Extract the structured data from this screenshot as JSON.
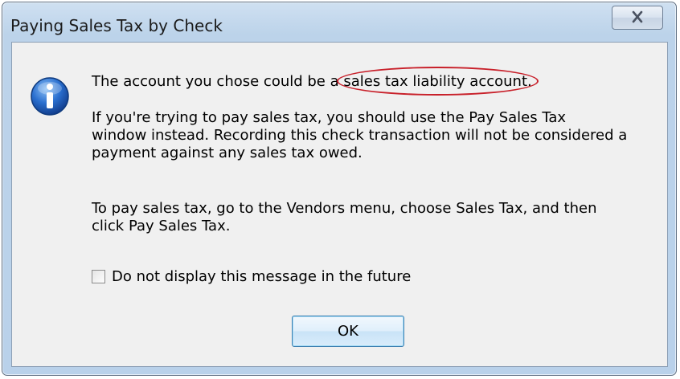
{
  "window": {
    "title": "Paying Sales Tax by Check",
    "close_label": "⊠"
  },
  "message": {
    "line1_prefix": "The account you chose could be a ",
    "line1_highlight": "sales tax liability account.",
    "para2_line1": "If you're trying to pay sales tax, you should use the Pay Sales Tax",
    "para2_line2": "window instead.  Recording this check transaction will not be considered a",
    "para2_line3": "payment against any sales tax owed.",
    "para3_line1": "To pay sales tax, go to the Vendors menu, choose Sales Tax, and then",
    "para3_line2": "click Pay Sales Tax."
  },
  "checkbox": {
    "label": "Do not display this message in the future",
    "checked": false
  },
  "buttons": {
    "ok_label": "OK"
  },
  "icons": {
    "info": "info-icon",
    "close": "close-icon"
  },
  "colors": {
    "highlight_ellipse": "#c8202a",
    "icon_blue": "#1f5db8"
  }
}
